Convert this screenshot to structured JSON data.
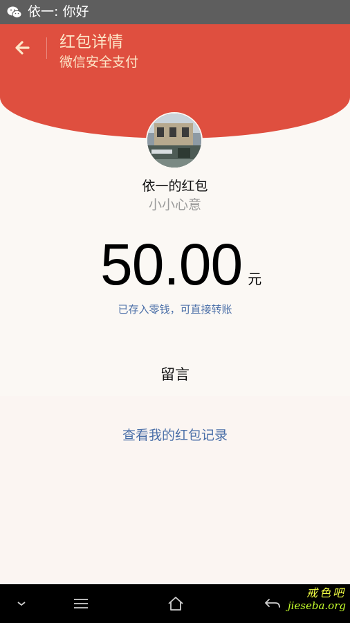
{
  "status_bar": {
    "icon": "wechat-icon",
    "notification_text": "依一: 你好"
  },
  "header": {
    "back_icon": "arrow-left-icon",
    "title": "红包详情",
    "subtitle": "微信安全支付",
    "background_color": "#df4f3f",
    "text_color": "#fde7c9"
  },
  "packet": {
    "sender_line": "依一的红包",
    "wish": "小小心意",
    "amount": "50.00",
    "unit": "元",
    "deposit_notice": "已存入零钱，可直接转账",
    "message_label": "留言",
    "records_link": "查看我的红包记录",
    "link_color": "#4b6fa8"
  },
  "nav_bar": {
    "buttons": [
      "chevron-down-icon",
      "menu-icon",
      "home-icon",
      "back-icon"
    ]
  },
  "watermark": {
    "chinese": "戒色吧",
    "url": "jieseba.org"
  }
}
